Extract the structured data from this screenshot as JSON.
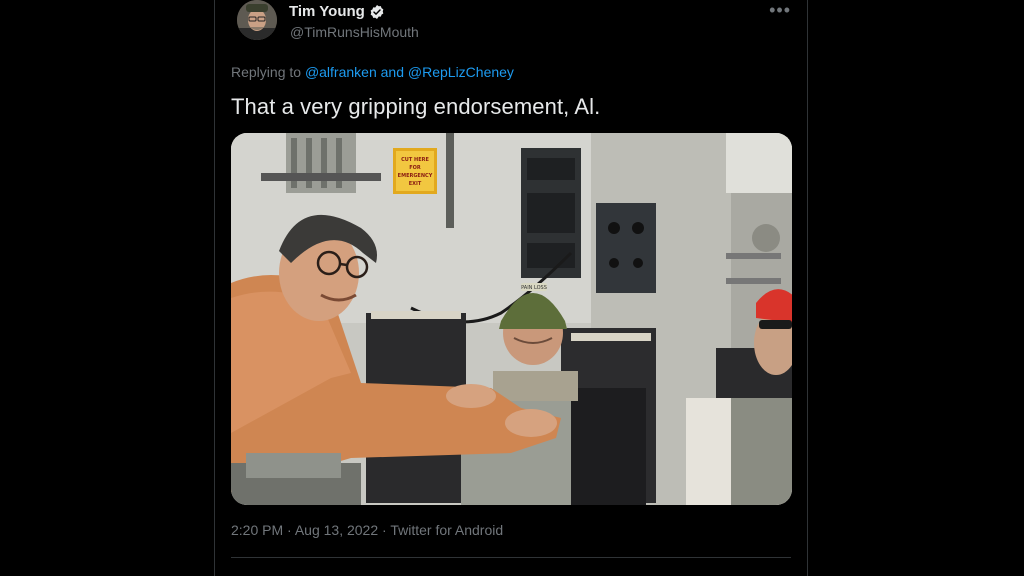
{
  "author": {
    "name": "Tim Young",
    "handle": "@TimRunsHisMouth",
    "avatar_alt": "avatar"
  },
  "more_icon": "more-horizontal-icon",
  "reply": {
    "prefix": "Replying to",
    "mention_1": "@alfranken",
    "joiner": "and",
    "mention_2": "@RepLizCheney"
  },
  "tweet": {
    "text": "That a very gripping endorsement, Al."
  },
  "media": {
    "sign_lines": [
      "CUT HERE",
      "FOR",
      "EMERGENCY",
      "EXIT"
    ],
    "helmet_label": "PAIN LOSS"
  },
  "meta": {
    "time": "2:20 PM",
    "sep1": "·",
    "date": "Aug 13, 2022",
    "sep2": "·",
    "source": "Twitter for Android"
  },
  "colors": {
    "background": "#000000",
    "text": "#e7e9ea",
    "secondary": "#71767b",
    "link": "#1d9bf0",
    "border": "#2f3336"
  }
}
